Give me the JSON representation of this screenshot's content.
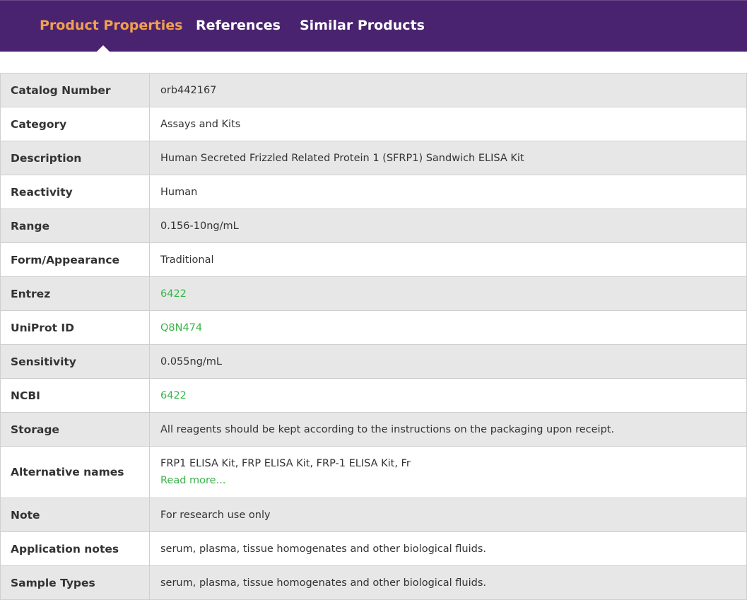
{
  "tabs": [
    {
      "label": "Product Properties",
      "active": true
    },
    {
      "label": "References",
      "active": false
    },
    {
      "label": "Similar Products",
      "active": false
    }
  ],
  "colors": {
    "header_bg": "#4a2370",
    "active_tab": "#f0a050",
    "link": "#3ab34a",
    "row_alt": "#e7e7e7"
  },
  "rows": [
    {
      "label": "Catalog Number",
      "value": "orb442167"
    },
    {
      "label": "Category",
      "value": "Assays and Kits"
    },
    {
      "label": "Description",
      "value": "Human Secreted Frizzled Related Protein 1 (SFRP1) Sandwich ELISA Kit"
    },
    {
      "label": "Reactivity",
      "value": "Human"
    },
    {
      "label": "Range",
      "value": "0.156-10ng/mL"
    },
    {
      "label": "Form/Appearance",
      "value": "Traditional"
    },
    {
      "label": "Entrez",
      "value": "6422"
    },
    {
      "label": "UniProt ID",
      "value": "Q8N474"
    },
    {
      "label": "Sensitivity",
      "value": "0.055ng/mL"
    },
    {
      "label": "NCBI",
      "value": "6422"
    },
    {
      "label": "Storage",
      "value": "All reagents should be kept according to the instructions on the packaging upon receipt."
    },
    {
      "label": "Alternative names",
      "value": "FRP1 ELISA Kit, FRP ELISA Kit, FRP-1 ELISA Kit, Fr",
      "read_more": "Read more..."
    },
    {
      "label": "Note",
      "value": "For research use only"
    },
    {
      "label": "Application notes",
      "value": "serum, plasma, tissue homogenates and other biological fluids."
    },
    {
      "label": "Sample Types",
      "value": "serum, plasma, tissue homogenates and other biological fluids."
    }
  ]
}
